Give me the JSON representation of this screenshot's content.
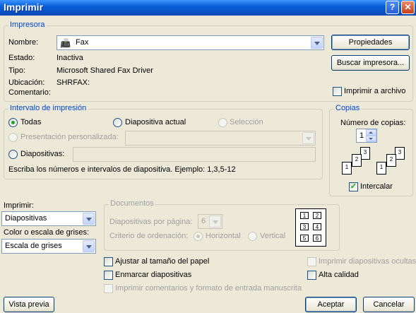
{
  "window": {
    "title": "Imprimir",
    "help_label": "?",
    "close_label": "✕"
  },
  "impresora": {
    "legend": "Impresora",
    "nombre_label": "Nombre:",
    "nombre_value": "Fax",
    "estado_label": "Estado:",
    "estado_value": "Inactiva",
    "tipo_label": "Tipo:",
    "tipo_value": "Microsoft Shared Fax Driver",
    "ubicacion_label": "Ubicación:",
    "ubicacion_value": "SHRFAX:",
    "comentario_label": "Comentario:",
    "propiedades_button": "Propiedades",
    "buscar_button": "Buscar impresora...",
    "imprimir_archivo_label": "Imprimir a archivo",
    "imprimir_archivo_checked": false
  },
  "intervalo": {
    "legend": "Intervalo de impresión",
    "todas_label": "Todas",
    "diapositiva_actual_label": "Diapositiva actual",
    "seleccion_label": "Selección",
    "presentacion_label": "Presentación personalizada:",
    "diapositivas_label": "Diapositivas:",
    "hint": "Escriba los números e intervalos de diapositiva. Ejemplo: 1,3,5-12",
    "selected": "todas"
  },
  "copias": {
    "legend": "Copias",
    "numero_label": "Número de copias:",
    "numero_value": "1",
    "intercalar_label": "Intercalar",
    "intercalar_checked": true,
    "collate_pages": [
      "1",
      "2",
      "3",
      "1",
      "2",
      "3"
    ]
  },
  "imprimir": {
    "label": "Imprimir:",
    "value": "Diapositivas",
    "color_label": "Color o escala de grises:",
    "color_value": "Escala de grises"
  },
  "documentos": {
    "legend": "Documentos",
    "por_pagina_label": "Diapositivas por página:",
    "por_pagina_value": "6",
    "criterio_label": "Criterio de ordenación:",
    "horizontal_label": "Horizontal",
    "vertical_label": "Vertical",
    "preview_cells": [
      "1",
      "2",
      "3",
      "4",
      "5",
      "6"
    ]
  },
  "options": {
    "ajustar_label": "Ajustar al tamaño del papel",
    "enmarcar_label": "Enmarcar diapositivas",
    "comentarios_label": "Imprimir comentarios y formato de entrada manuscrita",
    "ocultas_label": "Imprimir diapositivas ocultas",
    "alta_calidad_label": "Alta calidad"
  },
  "footer": {
    "vista_previa_button": "Vista previa",
    "aceptar_button": "Aceptar",
    "cancelar_button": "Cancelar"
  },
  "colors": {
    "title_blue": "#0a5fd8",
    "legend_blue": "#0046d5",
    "dialog_bg": "#ece9d8",
    "check_green": "#21a121"
  }
}
